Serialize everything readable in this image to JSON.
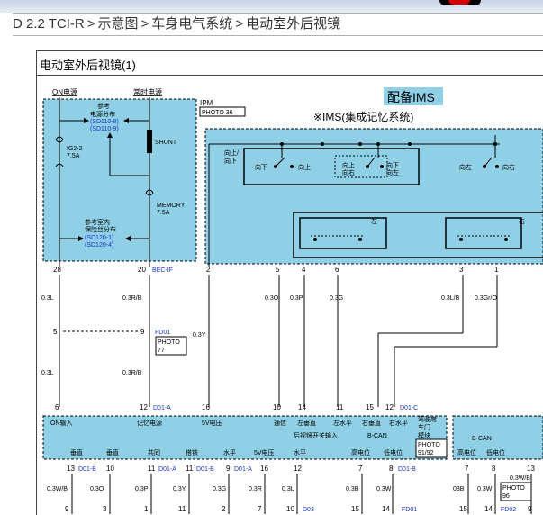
{
  "breadcrumb": {
    "items": [
      "D 2.2 TCI-R",
      "示意图",
      "车身电气系统",
      "电动室外后视镜"
    ],
    "separator": ">"
  },
  "diagram": {
    "title": "电动室外后视镜(1)",
    "ims_badge": "配备IMS",
    "ims_note": "※IMS(集成记忆系统)",
    "power_labels": {
      "on": "ON电源",
      "constant": "常时电源"
    },
    "ipm": {
      "name": "IPM",
      "photo": "PHOTO 36"
    },
    "ref_power": [
      "参考",
      "电源分布",
      "(SD110-8)",
      "(SD110-9)"
    ],
    "ref_fuse": [
      "参考室内",
      "保险丝分布",
      "(SD120-1)",
      "(SD120-4)"
    ],
    "fuse_ig": [
      "IG2-2",
      "7.5A"
    ],
    "shunt": "SHUNT",
    "memory": [
      "MEMORY",
      "7.5A"
    ],
    "switch_labels": {
      "up_down": [
        "向上/",
        "向下"
      ],
      "down": "向下",
      "up": "向上",
      "up_right": [
        "向上",
        "向右"
      ],
      "down_left": [
        "向下",
        "向左"
      ],
      "left_dir": "向左",
      "right_dir": "向右",
      "left": "左",
      "right": "右"
    },
    "pins_top": [
      "28",
      "20",
      "2",
      "5",
      "4",
      "6",
      "3",
      "1"
    ],
    "bec_label": "BEC-IF",
    "wires_top": [
      "0.3L",
      "0.3R/B",
      "0.3O",
      "0.3P",
      "0.3G",
      "0.3L/B",
      "0.3Gr/O"
    ],
    "fd01": {
      "label": "FD01",
      "photo": [
        "PHOTO",
        "77"
      ],
      "pin_left": "5",
      "pin_right": "9"
    },
    "wire_mid": "0.3Y",
    "wires_mid2": [
      "0.3L",
      "0.3R/B"
    ],
    "d01a": {
      "pins": [
        "6",
        "12"
      ],
      "label": "D01-A"
    },
    "pins_row2": [
      "16",
      "10",
      "14",
      "11",
      "15",
      "12"
    ],
    "d01c": "D01-C",
    "module_labels": {
      "on_input": "ON输入",
      "memory_power": "记忆电源",
      "v5_voltage": "5V电压",
      "common": "通信",
      "left_vertical": "左垂直",
      "left_horizontal": "左水平",
      "right_vertical": "右垂直",
      "right_horizontal": "右水平",
      "switch_input": "后视镜开关输入",
      "bcan": "B-CAN",
      "high_level": "高电位",
      "low_level": "低电位",
      "driver_module": [
        "驾驶席",
        "车门",
        "模块"
      ],
      "module_photo": [
        "PHOTO",
        "91/92"
      ],
      "bcan2": "B-CAN",
      "high_level2": "高电位",
      "low_level2": "低电位"
    },
    "bottom_labels": [
      "垂直",
      "垂直",
      "共同",
      "搭铁",
      "水平",
      "5V电压",
      "水平",
      "高电位",
      "低电位"
    ],
    "bottom_pins": [
      "13",
      "10",
      "11",
      "11",
      "9",
      "16",
      "12",
      "7",
      "8"
    ],
    "bottom_connectors": [
      "D01-B",
      "D01-A",
      "D01-B",
      "D01-A",
      "D01-B"
    ],
    "bottom_wires": [
      "0.3W/B",
      "0.3O",
      "0.3P",
      "0.3Y",
      "0.3G",
      "0.3R",
      "0.3L",
      "0.3B",
      "0.3W"
    ],
    "bottom_next_pins": [
      "9",
      "3",
      "1",
      "11",
      "2",
      "7",
      "10",
      "15",
      "14"
    ],
    "d03": "D03",
    "fd01_bottom": "FD01",
    "right_module": {
      "pins": [
        "7",
        "8",
        "13"
      ],
      "wire_label": "0.3W/B",
      "connector": "D01-B",
      "wires": [
        "03B",
        "0.3W"
      ],
      "photo": [
        "PHOTO",
        "96"
      ],
      "bottom_pins": [
        "15",
        "14"
      ],
      "fd02": "FD02",
      "last_pin": "9"
    }
  }
}
